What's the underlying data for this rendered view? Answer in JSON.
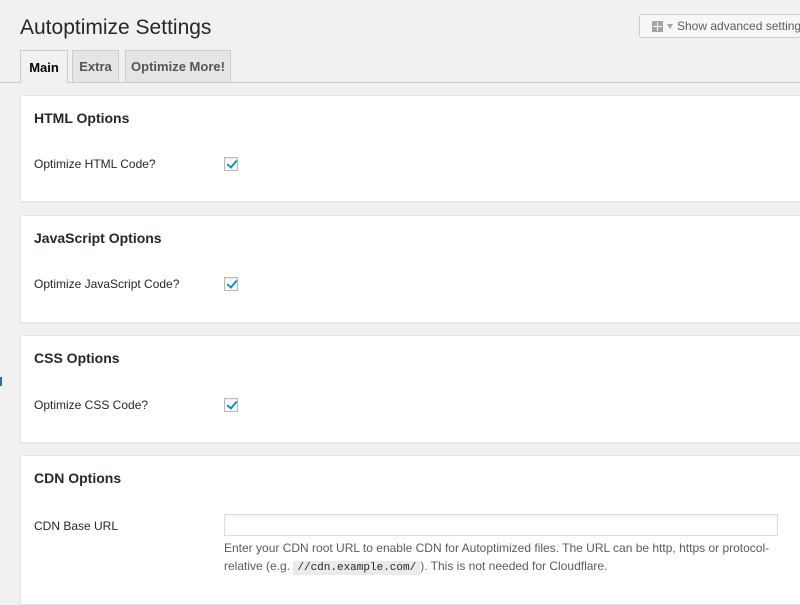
{
  "header": {
    "title": "Autoptimize Settings",
    "advanced_button": "Show advanced settings"
  },
  "tabs": [
    {
      "label": "Main",
      "active": true
    },
    {
      "label": "Extra",
      "active": false
    },
    {
      "label": "Optimize More!",
      "active": false
    }
  ],
  "sections": {
    "html": {
      "title": "HTML Options",
      "option_label": "Optimize HTML Code?",
      "checked": true
    },
    "js": {
      "title": "JavaScript Options",
      "option_label": "Optimize JavaScript Code?",
      "checked": true
    },
    "css": {
      "title": "CSS Options",
      "option_label": "Optimize CSS Code?",
      "checked": true
    },
    "cdn": {
      "title": "CDN Options",
      "option_label": "CDN Base URL",
      "input_value": "",
      "description_before": "Enter your CDN root URL to enable CDN for Autoptimized files. The URL can be http, https or protocol-relative (e.g. ",
      "description_code": "//cdn.example.com/",
      "description_after": "). This is not needed for Cloudflare."
    }
  },
  "icons": {
    "advanced_button_icon": "screen-options-icon",
    "advanced_button_caret": "caret-down-icon",
    "checkbox_mark": "checkmark-icon"
  },
  "colors": {
    "background": "#f1f1f1",
    "card": "#ffffff",
    "checkmark": "#1e8cbe",
    "text": "#23282d"
  }
}
